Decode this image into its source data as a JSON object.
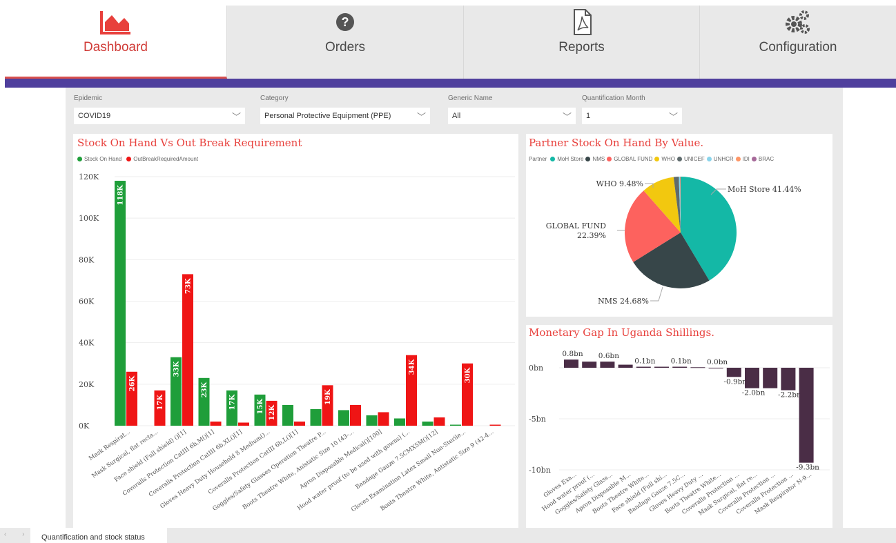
{
  "nav": {
    "tabs": [
      {
        "label": "Dashboard",
        "icon": "area-chart-icon",
        "active": true
      },
      {
        "label": "Orders",
        "icon": "question-circle-icon",
        "active": false
      },
      {
        "label": "Reports",
        "icon": "pdf-icon",
        "active": false
      },
      {
        "label": "Configuration",
        "icon": "gears-icon",
        "active": false
      }
    ]
  },
  "filters": {
    "epidemic": {
      "label": "Epidemic",
      "value": "COVID19"
    },
    "category": {
      "label": "Category",
      "value": "Personal Protective Equipment (PPE)"
    },
    "generic_name": {
      "label": "Generic Name",
      "value": "All"
    },
    "quantification_month": {
      "label": "Quantification Month",
      "value": "1"
    }
  },
  "colors": {
    "accent": "#e8403c",
    "band": "#4f3f9d",
    "stock": "#1f9e3a",
    "required": "#ef1515",
    "gap": "#4a2d46"
  },
  "chart_data": [
    {
      "type": "bar",
      "title": "Stock On Hand Vs Out Break Requirement",
      "legend_position": "top-left",
      "ylim": [
        0,
        120000
      ],
      "yticks": [
        "0K",
        "20K",
        "40K",
        "60K",
        "80K",
        "100K",
        "120K"
      ],
      "categories": [
        "Mask Respirat...",
        "Mask Surgical, flat recta...",
        "Face shield (Full shield) ()[1]",
        "Coveralls Protection CatIII 6b,M()[1]",
        "Coveralls Protection CatIII 6b,XL()[1]",
        "Gloves Heavy Duty Household 8 Medium()...",
        "Coveralls Protection CatIII 6b,L()[1]",
        "Goggles/Safety Glasses Operation Theatre P...",
        "Boots Theatre White, Anistatic Size 10 (43-...",
        "Apron Disposable Medical()[100]",
        "Hood water proof (to be used with gowns) (...",
        "Bandage Gauze 7.5CMX5M()[12]",
        "Gloves Examination Latex Small Non-Sterile...",
        "Boots Theatre White, Antistatic Size 9 (42-4..."
      ],
      "series": [
        {
          "name": "Stock On Hand",
          "values": [
            118000,
            0,
            33000,
            23000,
            17000,
            15000,
            10000,
            8000,
            7500,
            5000,
            3500,
            2000,
            500,
            0
          ],
          "labels": [
            "118K",
            "",
            "33K",
            "23K",
            "17K",
            "15K",
            "",
            "",
            "",
            "",
            "",
            "",
            "",
            ""
          ]
        },
        {
          "name": "OutBreakRequiredAmount",
          "values": [
            26000,
            17000,
            73000,
            2000,
            1500,
            12000,
            2000,
            19500,
            10000,
            6500,
            34000,
            4000,
            30000,
            500
          ],
          "labels": [
            "26K",
            "17K",
            "73K",
            "",
            "",
            "12K",
            "",
            "19K",
            "",
            "",
            "34K",
            "",
            "30K",
            ""
          ]
        }
      ]
    },
    {
      "type": "pie",
      "title": "Partner Stock On Hand By Value.",
      "legend_title": "Partner",
      "legend_position": "top",
      "legend": [
        "MoH Store",
        "NMS",
        "GLOBAL FUND",
        "WHO",
        "UNICEF",
        "UNHCR",
        "IDI",
        "BRAC"
      ],
      "slices": [
        {
          "name": "MoH Store",
          "value": 41.44,
          "label": "MoH Store 41.44%",
          "color": "#14b8a6"
        },
        {
          "name": "NMS",
          "value": 24.68,
          "label": "NMS 24.68%",
          "color": "#374649"
        },
        {
          "name": "GLOBAL FUND",
          "value": 22.39,
          "label_line1": "GLOBAL FUND",
          "label_line2": "22.39%",
          "color": "#fd625e"
        },
        {
          "name": "WHO",
          "value": 9.48,
          "label": "WHO 9.48%",
          "color": "#f2c80f"
        },
        {
          "name": "UNICEF",
          "value": 1.5,
          "color": "#5f6b6d"
        },
        {
          "name": "UNHCR",
          "value": 0.3,
          "color": "#8ad4eb"
        },
        {
          "name": "IDI",
          "value": 0.15,
          "color": "#fe9666"
        },
        {
          "name": "BRAC",
          "value": 0.06,
          "color": "#a66999"
        }
      ]
    },
    {
      "type": "bar",
      "title": "Monetary Gap In Uganda Shillings.",
      "ylim": [
        -10,
        1
      ],
      "yticks": [
        "-10bn",
        "-5bn",
        "0bn"
      ],
      "categories": [
        "Gloves Exa...",
        "Hood water proof (...",
        "Goggles/Safety Glass...",
        "Apron Disposable M...",
        "Boots Theatre White...",
        "Face shield (Full shi...",
        "Bandage Gauze 7.5C...",
        "Gloves Heavy Duty ...",
        "Boots Theatre White...",
        "Coveralls Protection ...",
        "Mask Surgical, flat re...",
        "Coveralls Protection ...",
        "Coveralls Protection ...",
        "Mask Respirator N-9..."
      ],
      "values": [
        0.8,
        0.6,
        0.6,
        0.3,
        0.1,
        0.1,
        0.1,
        0.05,
        0.0,
        -0.9,
        -2.0,
        -2.0,
        -2.2,
        -9.3
      ],
      "labels": [
        "0.8bn",
        "",
        "0.6bn",
        "",
        "0.1bn",
        "",
        "0.1bn",
        "",
        "0.0bn",
        "-0.9bn",
        "-2.0bn",
        "",
        "-2.2bn",
        "-9.3bn"
      ]
    }
  ],
  "footer": {
    "page_tab": "Quantification and stock status",
    "nav_arrows": "‹ ›"
  }
}
